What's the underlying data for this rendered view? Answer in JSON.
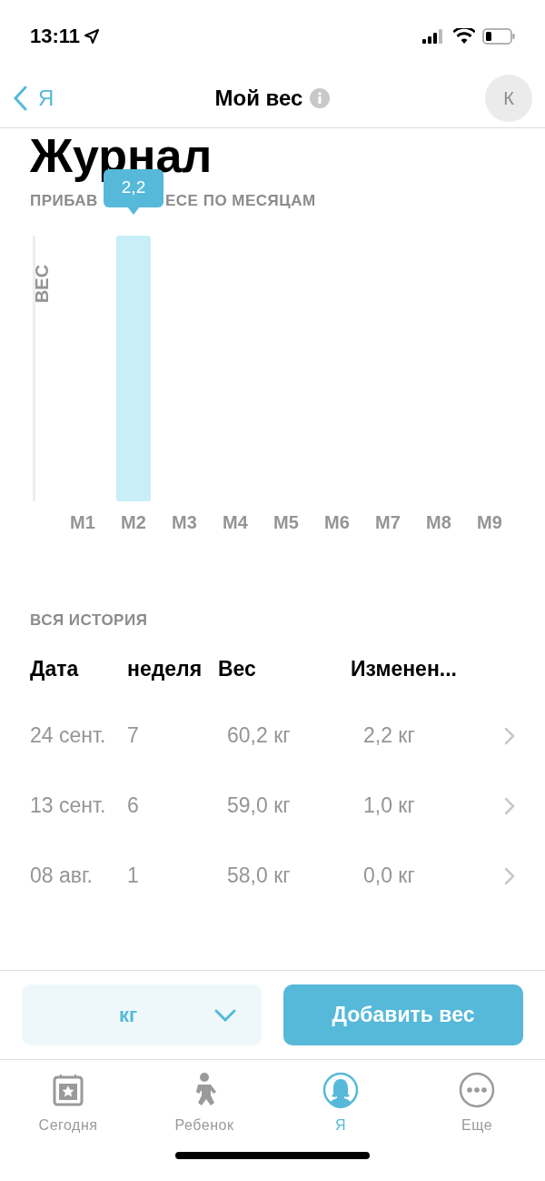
{
  "status_bar": {
    "time": "13:11"
  },
  "nav": {
    "back": "Я",
    "title": "Мой вес",
    "avatar": "К"
  },
  "title": "Журнал",
  "chart": {
    "subtitle_left": "ПРИБАВ",
    "subtitle_right": "ЕСЕ ПО МЕСЯЦАМ",
    "chart_data": {
      "type": "bar",
      "ylabel": "ВЕС",
      "categories": [
        "M1",
        "M2",
        "M3",
        "M4",
        "M5",
        "M6",
        "M7",
        "M8",
        "M9"
      ],
      "values": [
        null,
        2.2,
        null,
        null,
        null,
        null,
        null,
        null,
        null
      ],
      "value_labels": [
        null,
        "2,2",
        null,
        null,
        null,
        null,
        null,
        null,
        null
      ],
      "ylim": [
        0,
        2.2
      ]
    }
  },
  "history": {
    "heading": "ВСЯ ИСТОРИЯ",
    "columns": [
      "Дата",
      "неделя",
      "Вес",
      "Изменен..."
    ],
    "rows": [
      {
        "date": "24 сент.",
        "week": "7",
        "weight": "60,2 кг",
        "change": "2,2 кг"
      },
      {
        "date": "13 сент.",
        "week": "6",
        "weight": "59,0 кг",
        "change": "1,0 кг"
      },
      {
        "date": "08 авг.",
        "week": "1",
        "weight": "58,0 кг",
        "change": "0,0 кг"
      }
    ]
  },
  "unit_select": {
    "value": "кг"
  },
  "add_button": "Добавить вес",
  "tabs": [
    {
      "label": "Сегодня",
      "kind": "calendar",
      "selected": false
    },
    {
      "label": "Ребенок",
      "kind": "baby",
      "selected": false
    },
    {
      "label": "Я",
      "kind": "person",
      "selected": true
    },
    {
      "label": "Еще",
      "kind": "more",
      "selected": false
    }
  ]
}
